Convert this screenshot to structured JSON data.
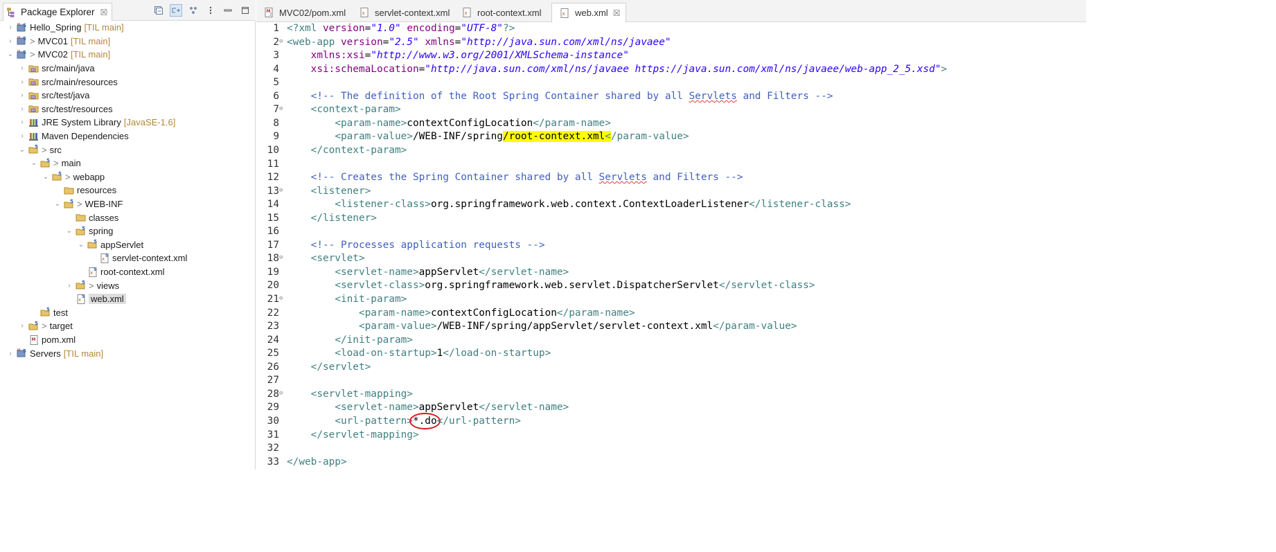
{
  "explorer": {
    "title": "Package Explorer",
    "close_glyph": "☒",
    "toolbar": [
      "collapse-all-icon",
      "link-with-editor-icon",
      "filters-icon",
      "view-menu-icon",
      "minimize-icon",
      "maximize-icon"
    ],
    "tree": [
      {
        "depth": 0,
        "expand": "closed",
        "icon": "project-icon",
        "prefix": "",
        "label": "Hello_Spring",
        "decoration": "[TIL main]"
      },
      {
        "depth": 0,
        "expand": "closed",
        "icon": "project-icon",
        "prefix": ">",
        "label": "MVC01",
        "decoration": "[TIL main]"
      },
      {
        "depth": 0,
        "expand": "open",
        "icon": "project-icon",
        "prefix": ">",
        "label": "MVC02",
        "decoration": "[TIL main]"
      },
      {
        "depth": 1,
        "expand": "closed",
        "icon": "source-folder-icon",
        "prefix": "",
        "label": "src/main/java",
        "decoration": ""
      },
      {
        "depth": 1,
        "expand": "closed",
        "icon": "source-folder-icon",
        "prefix": "",
        "label": "src/main/resources",
        "decoration": ""
      },
      {
        "depth": 1,
        "expand": "closed",
        "icon": "source-folder-icon",
        "prefix": "",
        "label": "src/test/java",
        "decoration": ""
      },
      {
        "depth": 1,
        "expand": "closed",
        "icon": "source-folder-icon",
        "prefix": "",
        "label": "src/test/resources",
        "decoration": ""
      },
      {
        "depth": 1,
        "expand": "closed",
        "icon": "library-icon",
        "prefix": "",
        "label": "JRE System Library",
        "decoration": "[JavaSE-1.6]"
      },
      {
        "depth": 1,
        "expand": "closed",
        "icon": "library-icon",
        "prefix": "",
        "label": "Maven Dependencies",
        "decoration": ""
      },
      {
        "depth": 1,
        "expand": "open",
        "icon": "folder-git-icon",
        "prefix": ">",
        "label": "src",
        "decoration": ""
      },
      {
        "depth": 2,
        "expand": "open",
        "icon": "folder-git-icon",
        "prefix": ">",
        "label": "main",
        "decoration": ""
      },
      {
        "depth": 3,
        "expand": "open",
        "icon": "folder-git-icon",
        "prefix": ">",
        "label": "webapp",
        "decoration": ""
      },
      {
        "depth": 4,
        "expand": "none",
        "icon": "folder-icon",
        "prefix": "",
        "label": "resources",
        "decoration": ""
      },
      {
        "depth": 4,
        "expand": "open",
        "icon": "folder-git-icon",
        "prefix": ">",
        "label": "WEB-INF",
        "decoration": ""
      },
      {
        "depth": 5,
        "expand": "none",
        "icon": "folder-icon",
        "prefix": "",
        "label": "classes",
        "decoration": ""
      },
      {
        "depth": 5,
        "expand": "open",
        "icon": "folder-git-icon",
        "prefix": "",
        "label": "spring",
        "decoration": ""
      },
      {
        "depth": 6,
        "expand": "open",
        "icon": "folder-git-icon",
        "prefix": "",
        "label": "appServlet",
        "decoration": ""
      },
      {
        "depth": 7,
        "expand": "none",
        "icon": "xml-file-icon",
        "prefix": "",
        "label": "servlet-context.xml",
        "decoration": ""
      },
      {
        "depth": 6,
        "expand": "none",
        "icon": "xml-file-icon",
        "prefix": "",
        "label": "root-context.xml",
        "decoration": ""
      },
      {
        "depth": 5,
        "expand": "closed",
        "icon": "folder-git-icon",
        "prefix": ">",
        "label": "views",
        "decoration": ""
      },
      {
        "depth": 5,
        "expand": "none",
        "icon": "xml-file-icon",
        "prefix": "",
        "label": "web.xml",
        "decoration": "",
        "selected": true
      },
      {
        "depth": 2,
        "expand": "none",
        "icon": "folder-git-icon",
        "prefix": "",
        "label": "test",
        "decoration": ""
      },
      {
        "depth": 1,
        "expand": "closed",
        "icon": "folder-git-icon",
        "prefix": ">",
        "label": "target",
        "decoration": ""
      },
      {
        "depth": 1,
        "expand": "none",
        "icon": "maven-file-icon",
        "prefix": "",
        "label": "pom.xml",
        "decoration": ""
      },
      {
        "depth": 0,
        "expand": "closed",
        "icon": "project-icon",
        "prefix": "",
        "label": "Servers",
        "decoration": "[TIL main]"
      }
    ]
  },
  "editor": {
    "tabs": [
      {
        "label": "MVC02/pom.xml",
        "icon": "maven-file-icon",
        "active": false
      },
      {
        "label": "servlet-context.xml",
        "icon": "xml-file-icon",
        "active": false
      },
      {
        "label": "root-context.xml",
        "icon": "xml-file-icon",
        "active": false
      },
      {
        "label": "web.xml",
        "icon": "xml-file-icon",
        "active": true,
        "close_glyph": "☒"
      }
    ],
    "lines": [
      {
        "n": "1",
        "fold": "",
        "segs": [
          [
            "pi",
            "<?"
          ],
          [
            "tag",
            "xml "
          ],
          [
            "attr",
            "version"
          ],
          [
            "body",
            "="
          ],
          [
            "val",
            "\"1.0\""
          ],
          [
            "body",
            " "
          ],
          [
            "attr",
            "encoding"
          ],
          [
            "body",
            "="
          ],
          [
            "val",
            "\"UTF-8\""
          ],
          [
            "pi",
            "?>"
          ]
        ]
      },
      {
        "n": "2",
        "fold": "⊖",
        "segs": [
          [
            "tag",
            "<web-app "
          ],
          [
            "attr",
            "version"
          ],
          [
            "body",
            "="
          ],
          [
            "val",
            "\"2.5\""
          ],
          [
            "body",
            " "
          ],
          [
            "attr",
            "xmlns"
          ],
          [
            "body",
            "="
          ],
          [
            "val",
            "\"http://java.sun.com/xml/ns/javaee\""
          ]
        ]
      },
      {
        "n": "3",
        "fold": "",
        "segs": [
          [
            "body",
            "    "
          ],
          [
            "attr",
            "xmlns:xsi"
          ],
          [
            "body",
            "="
          ],
          [
            "val",
            "\"http://www.w3.org/2001/XMLSchema-instance\""
          ]
        ]
      },
      {
        "n": "4",
        "fold": "",
        "segs": [
          [
            "body",
            "    "
          ],
          [
            "attr",
            "xsi:schemaLocation"
          ],
          [
            "body",
            "="
          ],
          [
            "val",
            "\"http://java.sun.com/xml/ns/javaee https://java.sun.com/xml/ns/javaee/web-app_2_5.xsd\""
          ],
          [
            "tag",
            ">"
          ]
        ]
      },
      {
        "n": "5",
        "fold": "",
        "segs": []
      },
      {
        "n": "6",
        "fold": "",
        "segs": [
          [
            "body",
            "    "
          ],
          [
            "com",
            "<!-- The definition of the Root Spring Container shared by all "
          ],
          [
            "com squig",
            "Servlets"
          ],
          [
            "com",
            " and Filters -->"
          ]
        ]
      },
      {
        "n": "7",
        "fold": "⊖",
        "segs": [
          [
            "body",
            "    "
          ],
          [
            "tag",
            "<context-param>"
          ]
        ]
      },
      {
        "n": "8",
        "fold": "",
        "segs": [
          [
            "body",
            "        "
          ],
          [
            "tag",
            "<param-name>"
          ],
          [
            "body",
            "contextConfigLocation"
          ],
          [
            "tag",
            "</param-name>"
          ]
        ]
      },
      {
        "n": "9",
        "fold": "",
        "segs": [
          [
            "body",
            "        "
          ],
          [
            "tag",
            "<param-value>"
          ],
          [
            "body",
            "/WEB-INF/spring"
          ],
          [
            "body hl",
            "/root-context.xml"
          ],
          [
            "tag hl",
            "<"
          ],
          [
            "tag",
            "/param-value>"
          ]
        ]
      },
      {
        "n": "10",
        "fold": "",
        "segs": [
          [
            "body",
            "    "
          ],
          [
            "tag",
            "</context-param>"
          ]
        ]
      },
      {
        "n": "11",
        "fold": "",
        "segs": []
      },
      {
        "n": "12",
        "fold": "",
        "segs": [
          [
            "body",
            "    "
          ],
          [
            "com",
            "<!-- Creates the Spring Container shared by all "
          ],
          [
            "com squig",
            "Servlets"
          ],
          [
            "com",
            " and Filters -->"
          ]
        ]
      },
      {
        "n": "13",
        "fold": "⊖",
        "segs": [
          [
            "body",
            "    "
          ],
          [
            "tag",
            "<listener>"
          ]
        ]
      },
      {
        "n": "14",
        "fold": "",
        "segs": [
          [
            "body",
            "        "
          ],
          [
            "tag",
            "<listener-class>"
          ],
          [
            "body",
            "org.springframework.web.context.ContextLoaderListener"
          ],
          [
            "tag",
            "</listener-class>"
          ]
        ]
      },
      {
        "n": "15",
        "fold": "",
        "segs": [
          [
            "body",
            "    "
          ],
          [
            "tag",
            "</listener>"
          ]
        ]
      },
      {
        "n": "16",
        "fold": "",
        "segs": []
      },
      {
        "n": "17",
        "fold": "",
        "segs": [
          [
            "body",
            "    "
          ],
          [
            "com",
            "<!-- Processes application requests -->"
          ]
        ]
      },
      {
        "n": "18",
        "fold": "⊖",
        "segs": [
          [
            "body",
            "    "
          ],
          [
            "tag",
            "<servlet>"
          ]
        ]
      },
      {
        "n": "19",
        "fold": "",
        "segs": [
          [
            "body",
            "        "
          ],
          [
            "tag",
            "<servlet-name>"
          ],
          [
            "body",
            "appServlet"
          ],
          [
            "tag",
            "</servlet-name>"
          ]
        ]
      },
      {
        "n": "20",
        "fold": "",
        "segs": [
          [
            "body",
            "        "
          ],
          [
            "tag",
            "<servlet-class>"
          ],
          [
            "body",
            "org.springframework.web.servlet.DispatcherServlet"
          ],
          [
            "tag",
            "</servlet-class>"
          ]
        ]
      },
      {
        "n": "21",
        "fold": "⊖",
        "segs": [
          [
            "body",
            "        "
          ],
          [
            "tag",
            "<init-param>"
          ]
        ]
      },
      {
        "n": "22",
        "fold": "",
        "segs": [
          [
            "body",
            "            "
          ],
          [
            "tag",
            "<param-name>"
          ],
          [
            "body",
            "contextConfigLocation"
          ],
          [
            "tag",
            "</param-name>"
          ]
        ]
      },
      {
        "n": "23",
        "fold": "",
        "segs": [
          [
            "body",
            "            "
          ],
          [
            "tag",
            "<param-value>"
          ],
          [
            "body",
            "/WEB-INF/spring/appServlet/servlet-context.xml"
          ],
          [
            "tag",
            "</param-value>"
          ]
        ]
      },
      {
        "n": "24",
        "fold": "",
        "segs": [
          [
            "body",
            "        "
          ],
          [
            "tag",
            "</init-param>"
          ]
        ]
      },
      {
        "n": "25",
        "fold": "",
        "segs": [
          [
            "body",
            "        "
          ],
          [
            "tag",
            "<load-on-startup>"
          ],
          [
            "body",
            "1"
          ],
          [
            "tag",
            "</load-on-startup>"
          ]
        ]
      },
      {
        "n": "26",
        "fold": "",
        "segs": [
          [
            "body",
            "    "
          ],
          [
            "tag",
            "</servlet>"
          ]
        ]
      },
      {
        "n": "27",
        "fold": "",
        "segs": []
      },
      {
        "n": "28",
        "fold": "⊖",
        "segs": [
          [
            "body",
            "    "
          ],
          [
            "tag",
            "<servlet-mapping>"
          ]
        ]
      },
      {
        "n": "29",
        "fold": "",
        "segs": [
          [
            "body",
            "        "
          ],
          [
            "tag",
            "<servlet-name>"
          ],
          [
            "body",
            "appServlet"
          ],
          [
            "tag",
            "</servlet-name>"
          ]
        ]
      },
      {
        "n": "30",
        "fold": "",
        "segs": [
          [
            "body",
            "        "
          ],
          [
            "tag",
            "<url-pattern>"
          ],
          [
            "body circle",
            "*.do"
          ],
          [
            "tag",
            "</url-pattern>"
          ]
        ]
      },
      {
        "n": "31",
        "fold": "",
        "segs": [
          [
            "body",
            "    "
          ],
          [
            "tag",
            "</servlet-mapping>"
          ]
        ]
      },
      {
        "n": "32",
        "fold": "",
        "segs": []
      },
      {
        "n": "33",
        "fold": "",
        "segs": [
          [
            "tag",
            "</web-app>"
          ]
        ]
      }
    ]
  },
  "colors": {
    "tag": "#3f7f7f",
    "attribute": "#7f007f",
    "value": "#2a00ff",
    "comment": "#3f5fbf",
    "highlight": "#ffff00",
    "annotation_circle": "#d61c1c",
    "decoration": "#b5863a"
  }
}
